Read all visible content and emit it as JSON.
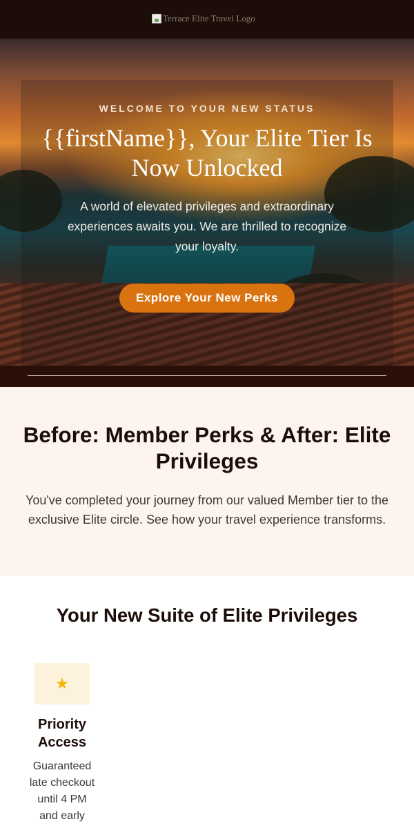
{
  "header": {
    "logo_alt": "Terrace Elite Travel Logo"
  },
  "hero": {
    "eyebrow": "WELCOME TO YOUR NEW STATUS",
    "title": "{{firstName}}, Your Elite Tier Is Now Unlocked",
    "text": "A world of elevated privileges and extraordinary experiences awaits you. We are thrilled to recognize your loyalty.",
    "cta_label": "Explore Your New Perks"
  },
  "compare": {
    "title": "Before: Member Perks & After: Elite Privileges",
    "text": "You've completed your journey from our valued Member tier to the exclusive Elite circle. See how your travel experience transforms."
  },
  "privileges": {
    "title": "Your New Suite of Elite Privileges",
    "cards": [
      {
        "icon": "star-icon",
        "title": "Priority Access",
        "text": "Guaranteed late checkout until 4 PM and early"
      }
    ]
  },
  "colors": {
    "header_bg": "#1c0d08",
    "accent": "#d8730f",
    "compare_bg": "#fdf4ee",
    "icon_bg": "#fdf3dc"
  }
}
